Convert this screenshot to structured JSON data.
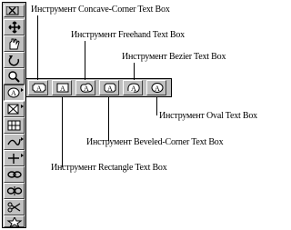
{
  "toolbar": {
    "tools": [
      {
        "icon": "close-icon"
      },
      {
        "icon": "item-tool-icon"
      },
      {
        "icon": "content-tool-icon"
      },
      {
        "icon": "rotate-tool-icon"
      },
      {
        "icon": "zoom-tool-icon"
      },
      {
        "icon": "text-box-tool-icon"
      },
      {
        "icon": "picture-box-tool-icon"
      },
      {
        "icon": "table-tool-icon"
      },
      {
        "icon": "line-tool-icon"
      },
      {
        "icon": "orthogonal-line-tool-icon"
      },
      {
        "icon": "linking-tool-icon"
      },
      {
        "icon": "unlinking-tool-icon"
      },
      {
        "icon": "scissors-tool-icon"
      },
      {
        "icon": "star-tool-icon"
      }
    ]
  },
  "callouts": {
    "concave_corner": "Инструмент Concave-Corner Text Box",
    "freehand": "Инструмент Freehand Text Box",
    "bezier": "Инструмент Bezier Text Box",
    "oval": "Инструмент Oval Text Box",
    "beveled_corner": "Инструмент Beveled-Corner Text Box",
    "rectangle": "Инструмент Rectangle Text Box"
  }
}
